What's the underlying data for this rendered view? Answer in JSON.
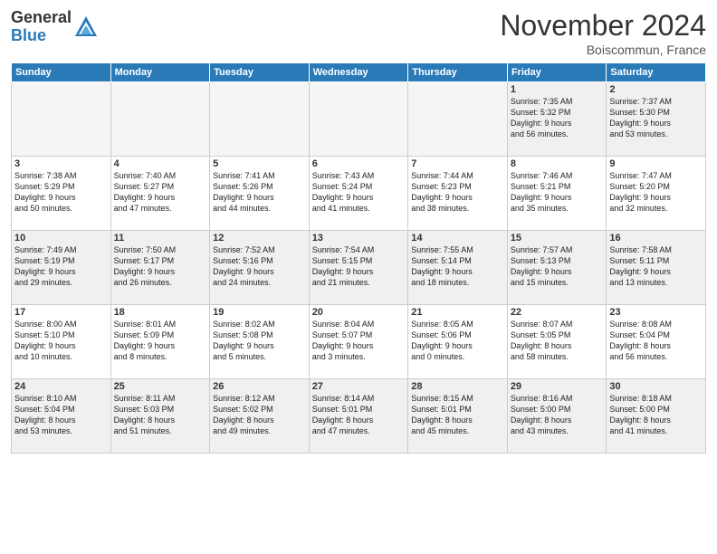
{
  "header": {
    "logo_general": "General",
    "logo_blue": "Blue",
    "month_title": "November 2024",
    "location": "Boiscommun, France"
  },
  "days_of_week": [
    "Sunday",
    "Monday",
    "Tuesday",
    "Wednesday",
    "Thursday",
    "Friday",
    "Saturday"
  ],
  "weeks": [
    [
      {
        "day": "",
        "info": "",
        "empty": true
      },
      {
        "day": "",
        "info": "",
        "empty": true
      },
      {
        "day": "",
        "info": "",
        "empty": true
      },
      {
        "day": "",
        "info": "",
        "empty": true
      },
      {
        "day": "",
        "info": "",
        "empty": true
      },
      {
        "day": "1",
        "info": "Sunrise: 7:35 AM\nSunset: 5:32 PM\nDaylight: 9 hours\nand 56 minutes."
      },
      {
        "day": "2",
        "info": "Sunrise: 7:37 AM\nSunset: 5:30 PM\nDaylight: 9 hours\nand 53 minutes."
      }
    ],
    [
      {
        "day": "3",
        "info": "Sunrise: 7:38 AM\nSunset: 5:29 PM\nDaylight: 9 hours\nand 50 minutes."
      },
      {
        "day": "4",
        "info": "Sunrise: 7:40 AM\nSunset: 5:27 PM\nDaylight: 9 hours\nand 47 minutes."
      },
      {
        "day": "5",
        "info": "Sunrise: 7:41 AM\nSunset: 5:26 PM\nDaylight: 9 hours\nand 44 minutes."
      },
      {
        "day": "6",
        "info": "Sunrise: 7:43 AM\nSunset: 5:24 PM\nDaylight: 9 hours\nand 41 minutes."
      },
      {
        "day": "7",
        "info": "Sunrise: 7:44 AM\nSunset: 5:23 PM\nDaylight: 9 hours\nand 38 minutes."
      },
      {
        "day": "8",
        "info": "Sunrise: 7:46 AM\nSunset: 5:21 PM\nDaylight: 9 hours\nand 35 minutes."
      },
      {
        "day": "9",
        "info": "Sunrise: 7:47 AM\nSunset: 5:20 PM\nDaylight: 9 hours\nand 32 minutes."
      }
    ],
    [
      {
        "day": "10",
        "info": "Sunrise: 7:49 AM\nSunset: 5:19 PM\nDaylight: 9 hours\nand 29 minutes."
      },
      {
        "day": "11",
        "info": "Sunrise: 7:50 AM\nSunset: 5:17 PM\nDaylight: 9 hours\nand 26 minutes."
      },
      {
        "day": "12",
        "info": "Sunrise: 7:52 AM\nSunset: 5:16 PM\nDaylight: 9 hours\nand 24 minutes."
      },
      {
        "day": "13",
        "info": "Sunrise: 7:54 AM\nSunset: 5:15 PM\nDaylight: 9 hours\nand 21 minutes."
      },
      {
        "day": "14",
        "info": "Sunrise: 7:55 AM\nSunset: 5:14 PM\nDaylight: 9 hours\nand 18 minutes."
      },
      {
        "day": "15",
        "info": "Sunrise: 7:57 AM\nSunset: 5:13 PM\nDaylight: 9 hours\nand 15 minutes."
      },
      {
        "day": "16",
        "info": "Sunrise: 7:58 AM\nSunset: 5:11 PM\nDaylight: 9 hours\nand 13 minutes."
      }
    ],
    [
      {
        "day": "17",
        "info": "Sunrise: 8:00 AM\nSunset: 5:10 PM\nDaylight: 9 hours\nand 10 minutes."
      },
      {
        "day": "18",
        "info": "Sunrise: 8:01 AM\nSunset: 5:09 PM\nDaylight: 9 hours\nand 8 minutes."
      },
      {
        "day": "19",
        "info": "Sunrise: 8:02 AM\nSunset: 5:08 PM\nDaylight: 9 hours\nand 5 minutes."
      },
      {
        "day": "20",
        "info": "Sunrise: 8:04 AM\nSunset: 5:07 PM\nDaylight: 9 hours\nand 3 minutes."
      },
      {
        "day": "21",
        "info": "Sunrise: 8:05 AM\nSunset: 5:06 PM\nDaylight: 9 hours\nand 0 minutes."
      },
      {
        "day": "22",
        "info": "Sunrise: 8:07 AM\nSunset: 5:05 PM\nDaylight: 8 hours\nand 58 minutes."
      },
      {
        "day": "23",
        "info": "Sunrise: 8:08 AM\nSunset: 5:04 PM\nDaylight: 8 hours\nand 56 minutes."
      }
    ],
    [
      {
        "day": "24",
        "info": "Sunrise: 8:10 AM\nSunset: 5:04 PM\nDaylight: 8 hours\nand 53 minutes."
      },
      {
        "day": "25",
        "info": "Sunrise: 8:11 AM\nSunset: 5:03 PM\nDaylight: 8 hours\nand 51 minutes."
      },
      {
        "day": "26",
        "info": "Sunrise: 8:12 AM\nSunset: 5:02 PM\nDaylight: 8 hours\nand 49 minutes."
      },
      {
        "day": "27",
        "info": "Sunrise: 8:14 AM\nSunset: 5:01 PM\nDaylight: 8 hours\nand 47 minutes."
      },
      {
        "day": "28",
        "info": "Sunrise: 8:15 AM\nSunset: 5:01 PM\nDaylight: 8 hours\nand 45 minutes."
      },
      {
        "day": "29",
        "info": "Sunrise: 8:16 AM\nSunset: 5:00 PM\nDaylight: 8 hours\nand 43 minutes."
      },
      {
        "day": "30",
        "info": "Sunrise: 8:18 AM\nSunset: 5:00 PM\nDaylight: 8 hours\nand 41 minutes."
      }
    ]
  ]
}
